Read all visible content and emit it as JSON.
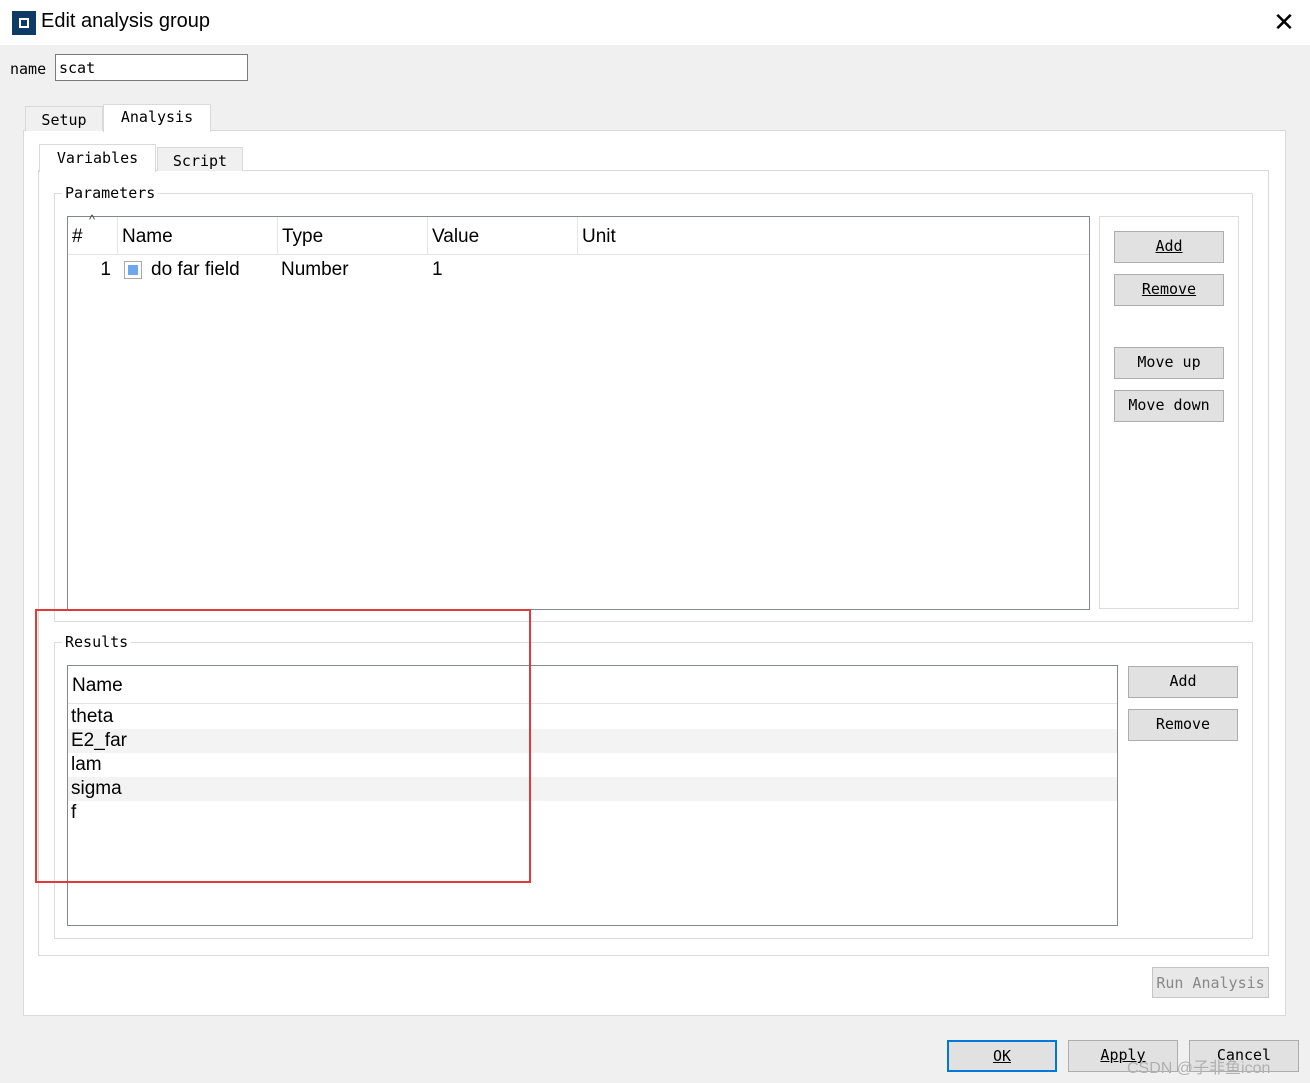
{
  "window": {
    "title": "Edit analysis group",
    "close_glyph": "✕"
  },
  "name_field": {
    "label": "name",
    "value": "scat"
  },
  "outer_tabs": [
    {
      "label": "Setup"
    },
    {
      "label": "Analysis"
    }
  ],
  "inner_tabs": [
    {
      "label": "Variables"
    },
    {
      "label": "Script"
    }
  ],
  "parameters": {
    "legend": "Parameters",
    "columns": [
      "#",
      "Name",
      "Type",
      "Value",
      "Unit"
    ],
    "rows": [
      {
        "index": "1",
        "name": "do far field",
        "type": "Number",
        "value": "1",
        "unit": ""
      }
    ],
    "buttons": {
      "add": "Add",
      "remove": "Remove",
      "move_up": "Move up",
      "move_down": "Move down"
    }
  },
  "results": {
    "legend": "Results",
    "column": "Name",
    "rows": [
      "theta",
      "E2_far",
      "lam",
      "sigma",
      "f"
    ],
    "buttons": {
      "add": "Add",
      "remove": "Remove"
    }
  },
  "run_button": "Run Analysis",
  "dialog_buttons": {
    "ok": "OK",
    "apply": "Apply",
    "cancel": "Cancel"
  },
  "watermark": "CSDN @子非鱼icon",
  "icons": {
    "app": "lumerical-app-icon",
    "swatch": "parameter-color-swatch"
  },
  "colors": {
    "highlight": "#e03a3a",
    "swatch": "#6da7f0",
    "focus": "#0078d7"
  }
}
